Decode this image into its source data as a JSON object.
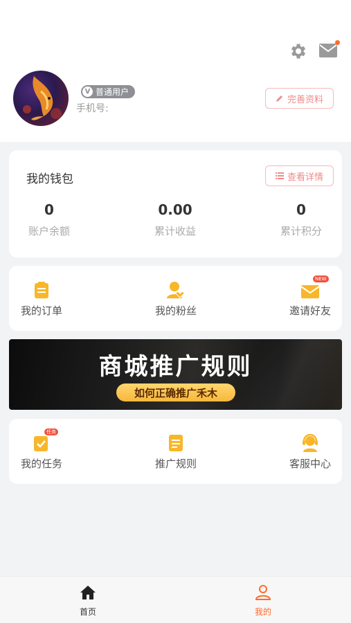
{
  "header": {
    "settings_icon": "gear-icon",
    "mail_icon": "mail-icon",
    "user_badge": "普通用户",
    "phone_label": "手机号:",
    "edit_profile_label": "完善资料"
  },
  "wallet": {
    "title": "我的钱包",
    "detail_label": "查看详情",
    "stats": [
      {
        "value": "0",
        "label": "账户余额"
      },
      {
        "value": "0.00",
        "label": "累计收益"
      },
      {
        "value": "0",
        "label": "累计积分"
      }
    ]
  },
  "menu1": {
    "items": [
      {
        "label": "我的订单",
        "icon": "order-icon"
      },
      {
        "label": "我的粉丝",
        "icon": "fans-icon"
      },
      {
        "label": "邀请好友",
        "icon": "invite-icon",
        "tag": "NEW"
      }
    ]
  },
  "banner": {
    "title": "商城推广规则",
    "subtitle": "如何正确推广禾木"
  },
  "menu2": {
    "items": [
      {
        "label": "我的任务",
        "icon": "task-icon",
        "tag": "任务"
      },
      {
        "label": "推广规则",
        "icon": "rules-icon"
      },
      {
        "label": "客服中心",
        "icon": "support-icon"
      }
    ]
  },
  "tabbar": {
    "items": [
      {
        "label": "首页",
        "icon": "home-icon"
      },
      {
        "label": "我的",
        "icon": "user-icon"
      }
    ]
  },
  "colors": {
    "accent": "#ff6a2a",
    "icon_yellow": "#f8b62a",
    "outline_red": "#f08a8a"
  }
}
